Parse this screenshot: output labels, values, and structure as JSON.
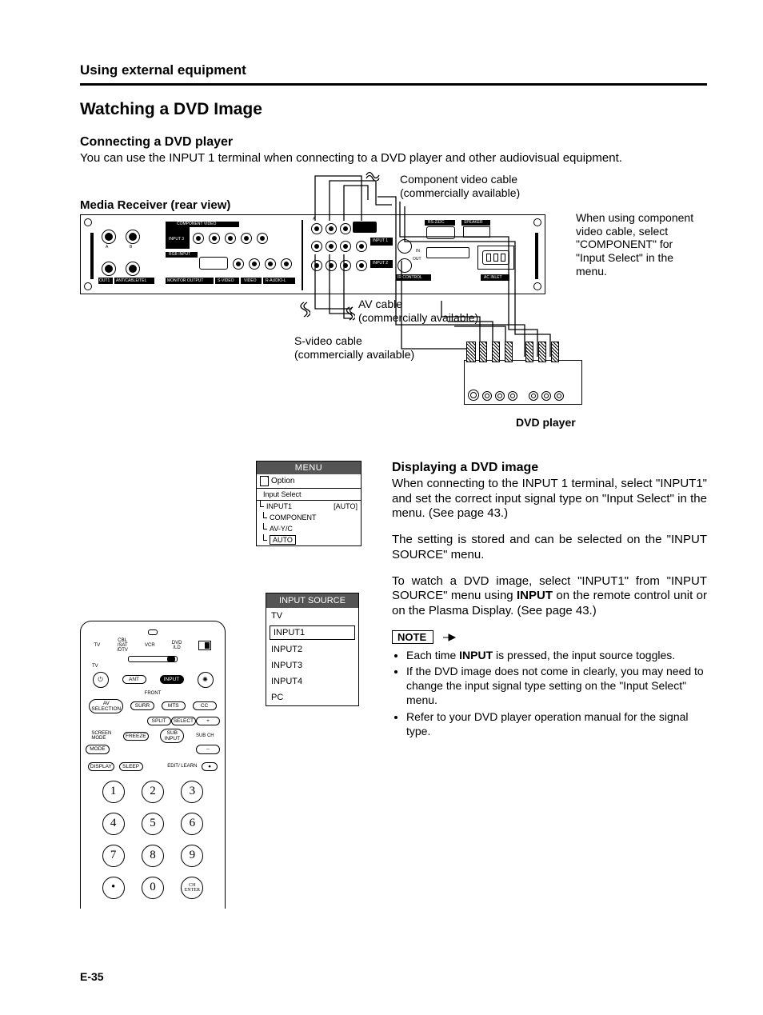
{
  "section_header": "Using external equipment",
  "title": "Watching a DVD Image",
  "connecting": {
    "heading": "Connecting a DVD player",
    "body": "You can use the INPUT 1 terminal when connecting to a DVD player and other audiovisual equipment."
  },
  "diagram": {
    "media_label": "Media Receiver (rear view)",
    "component_cable_l1": "Component  video cable",
    "component_cable_l2": "(commercially available)",
    "av_cable_l1": "AV cable",
    "av_cable_l2": "(commercially available)",
    "svideo_l1": "S-video cable",
    "svideo_l2": "(commercially available)",
    "tip_l1": "When using component",
    "tip_l2": "video cable, select",
    "tip_l3": "\"COMPONENT\" for",
    "tip_l4": "\"Input Select\" in the",
    "tip_l5": "menu.",
    "dvd_label": "DVD player",
    "panel_labels": {
      "component_video": "COMPONENT VIDEO",
      "input3": "INPUT 3",
      "input1": "INPUT 1",
      "input2": "INPUT 2",
      "rgb_input": "RGB INPUT",
      "monitor_output": "MONITOR OUTPUT",
      "svideo": "S-VIDEO",
      "video": "VIDEO",
      "raudiol": "R-AUDIO-L",
      "rs232c": "RS-232C",
      "speaker": "SPEAKER",
      "ir_control": "IR CONTROL",
      "ac_inlet": "AC INLET",
      "out1": "OUT1",
      "ant_cable": "ANT/CABLE/TEL",
      "a": "A",
      "b": "B",
      "out": "OUT",
      "in": "IN"
    }
  },
  "menu_box": {
    "title": "MENU",
    "option": "Option",
    "input_select": "Input Select",
    "input1": "INPUT1",
    "auto": "[AUTO]",
    "component": "COMPONENT",
    "avyc": "AV-Y/C",
    "auto2": "AUTO"
  },
  "input_source": {
    "title": "INPUT SOURCE",
    "items": [
      "TV",
      "INPUT1",
      "INPUT2",
      "INPUT3",
      "INPUT4",
      "PC"
    ]
  },
  "displaying": {
    "heading": "Displaying a DVD image",
    "p1": "When connecting to the INPUT 1 terminal, select \"INPUT1\" and set the correct input signal type on \"Input Select\" in the menu. (See page 43.)",
    "p2": "The setting is stored and can be selected on the \"INPUT SOURCE\" menu.",
    "p3a": "To watch a DVD image, select \"INPUT1\" from \"INPUT SOURCE\" menu using ",
    "p3_bold": "INPUT",
    "p3b": " on the remote control unit or on the Plasma Display. (See page 43.)"
  },
  "note": {
    "label": "NOTE",
    "b1a": "Each time ",
    "b1_bold": "INPUT",
    "b1b": " is pressed, the input source toggles.",
    "b2": "If the DVD image does not come in clearly, you may need to change the input signal type setting on the \"Input Select\" menu.",
    "b3": "Refer to your DVD player operation manual for the signal type."
  },
  "remote": {
    "top_labels": [
      "TV",
      "CBL\n/SAT\n/DTV",
      "VCR",
      "DVD\n/LD"
    ],
    "tv": "TV",
    "ant": "ANT",
    "input": "INPUT",
    "front": "FRONT",
    "av_selection": "AV\nSELECTION",
    "surr": "SURR",
    "mts": "MTS",
    "cc": "CC",
    "split": "SPLIT",
    "select": "SELECT",
    "plus": "+",
    "screen_mode": "SCREEN\nMODE",
    "freeze": "FREEZE",
    "sub_input": "SUB\nINPUT",
    "sub_ch": "SUB CH",
    "minus": "–",
    "display": "DISPLAY",
    "sleep": "SLEEP",
    "edit_learn": "EDIT/ LEARN",
    "numbers": [
      "1",
      "2",
      "3",
      "4",
      "5",
      "6",
      "7",
      "8",
      "9",
      "•",
      "0",
      "CH\nENTER"
    ]
  },
  "page_number": "E-35"
}
